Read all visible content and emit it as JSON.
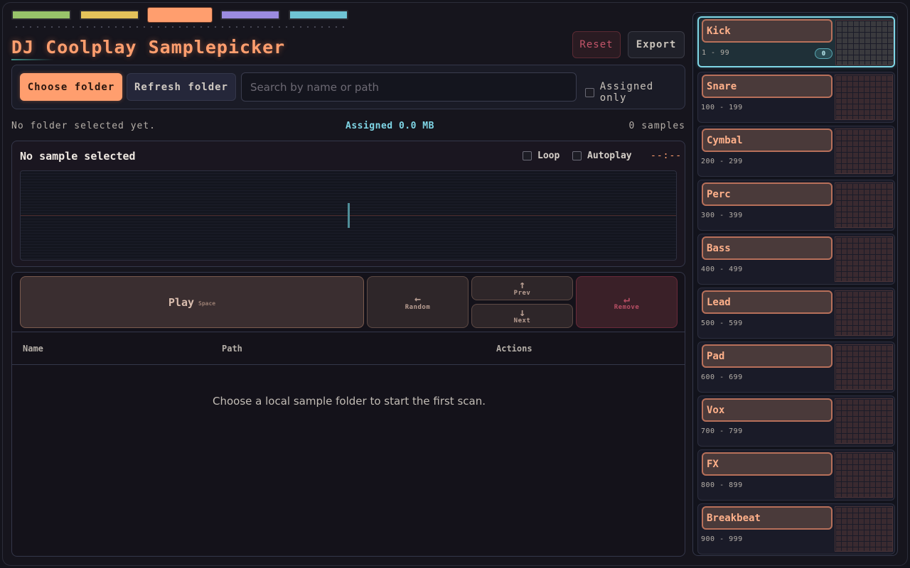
{
  "colors": {
    "accent": "#ff9e6e",
    "cyan": "#7fd6e6",
    "danger": "#c4556a",
    "tabs": [
      "#98c46a",
      "#e4c35a",
      "#ff9e6e",
      "#9c8ce0",
      "#6fc4d4"
    ]
  },
  "header": {
    "title": "DJ Coolplay Samplepicker",
    "reset_label": "Reset",
    "export_label": "Export"
  },
  "toolbar": {
    "choose_folder_label": "Choose folder",
    "refresh_folder_label": "Refresh folder",
    "search_placeholder": "Search by name or path",
    "assigned_only_label": "Assigned only"
  },
  "status": {
    "folder": "No folder selected yet.",
    "assigned": "Assigned 0.0 MB",
    "samples": "0 samples"
  },
  "player": {
    "title": "No sample selected",
    "loop_label": "Loop",
    "autoplay_label": "Autoplay",
    "time": "--:--"
  },
  "controls": {
    "play_label": "Play",
    "play_key": "Space",
    "random_label": "Random",
    "random_icon": "←",
    "prev_label": "Prev",
    "prev_icon": "↑",
    "next_label": "Next",
    "next_icon": "↓",
    "remove_label": "Remove",
    "remove_icon": "↵"
  },
  "table": {
    "columns": [
      "Name",
      "Path",
      "Actions"
    ],
    "empty_message": "Choose a local sample folder to start the first scan."
  },
  "banks": [
    {
      "name": "Kick",
      "range": "1 - 99",
      "count": "0",
      "active": true
    },
    {
      "name": "Snare",
      "range": "100 - 199"
    },
    {
      "name": "Cymbal",
      "range": "200 - 299"
    },
    {
      "name": "Perc",
      "range": "300 - 399"
    },
    {
      "name": "Bass",
      "range": "400 - 499"
    },
    {
      "name": "Lead",
      "range": "500 - 599"
    },
    {
      "name": "Pad",
      "range": "600 - 699"
    },
    {
      "name": "Vox",
      "range": "700 - 799"
    },
    {
      "name": "FX",
      "range": "800 - 899"
    },
    {
      "name": "Breakbeat",
      "range": "900 - 999"
    }
  ]
}
